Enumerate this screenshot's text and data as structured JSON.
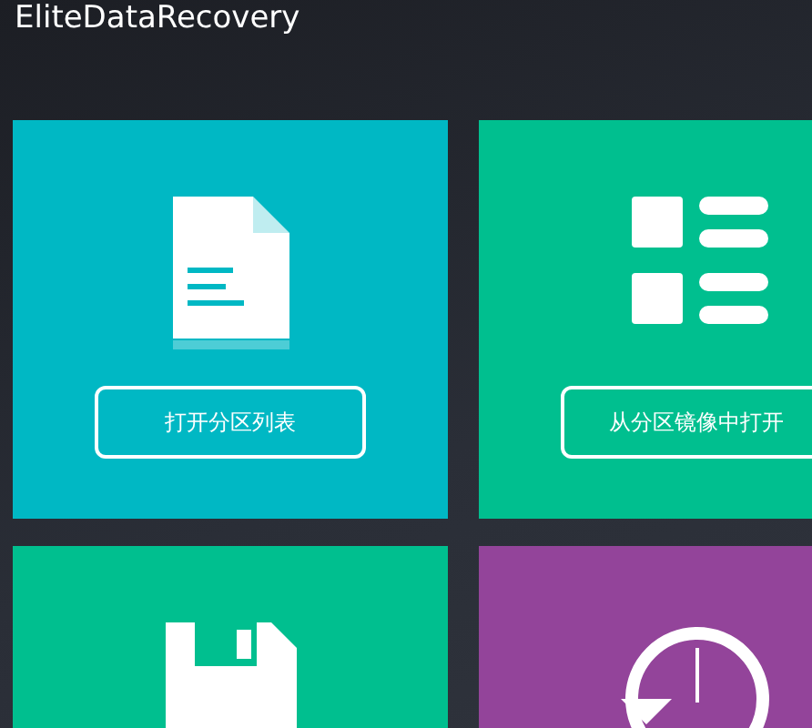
{
  "window": {
    "title": "EliteDataRecovery"
  },
  "tiles": [
    {
      "kind": "document",
      "color": "#00b8c4",
      "button": "打开分区列表"
    },
    {
      "kind": "list",
      "color": "#00bf8f",
      "button": "从分区镜像中打开"
    },
    {
      "kind": "floppy",
      "color": "#00bf8f"
    },
    {
      "kind": "history",
      "color": "#93449a"
    }
  ]
}
